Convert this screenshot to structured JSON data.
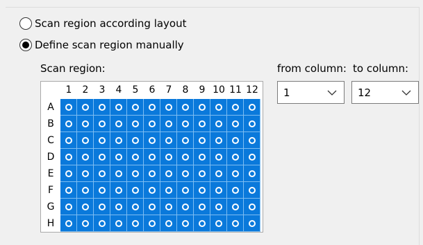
{
  "scan_mode": {
    "option_layout": "Scan region according layout",
    "option_manual": "Define scan region manually",
    "selected": "manual"
  },
  "scan_region": {
    "label": "Scan region:",
    "columns": [
      "1",
      "2",
      "3",
      "4",
      "5",
      "6",
      "7",
      "8",
      "9",
      "10",
      "11",
      "12"
    ],
    "rows": [
      "A",
      "B",
      "C",
      "D",
      "E",
      "F",
      "G",
      "H"
    ],
    "well_color": "#0a79db"
  },
  "from_column": {
    "label": "from column:",
    "value": "1"
  },
  "to_column": {
    "label": "to column:",
    "value": "12"
  }
}
